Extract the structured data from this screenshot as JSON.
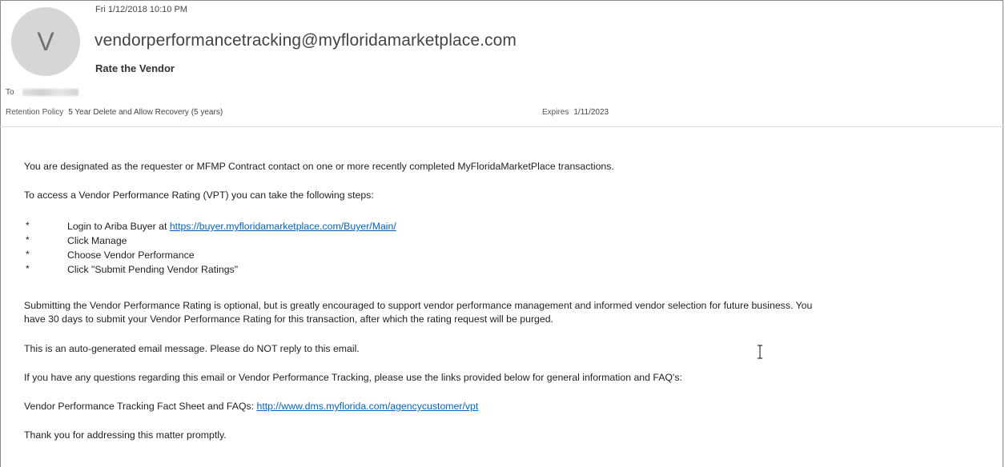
{
  "header": {
    "avatar_letter": "V",
    "date": "Fri 1/12/2018 10:10 PM",
    "sender": "vendorperformancetracking@myfloridamarketplace.com",
    "subject": "Rate the Vendor",
    "to_label": "To",
    "retention_label": "Retention Policy",
    "retention_value": "5 Year Delete and Allow Recovery (5 years)",
    "expires_label": "Expires",
    "expires_value": "1/11/2023"
  },
  "body": {
    "intro": "You are designated as the requester or MFMP Contract contact on one or more recently completed MyFloridaMarketPlace transactions.",
    "steps_intro": "To access a Vendor Performance Rating (VPT) you can take the following steps:",
    "bullet_char": "*",
    "step1_text": "Login to Ariba Buyer at ",
    "step1_link": "https://buyer.myfloridamarketplace.com/Buyer/Main/",
    "step2": "Click Manage",
    "step3": "Choose Vendor Performance",
    "step4": "Click \"Submit Pending Vendor Ratings\"",
    "optional_line1": "Submitting the Vendor Performance Rating is optional, but is greatly encouraged to support vendor performance management and informed vendor selection for future business.  You",
    "optional_line2": "have 30 days to submit your Vendor Performance Rating for this transaction, after which the rating request will be purged.",
    "auto_generated": "This is an auto-generated email message.  Please do NOT reply to this email.",
    "questions": "If you have any questions regarding this email or Vendor Performance Tracking, please use the links provided below for general information and FAQ's:",
    "factsheet_text": "Vendor Performance Tracking Fact Sheet and FAQs: ",
    "factsheet_link": "http://www.dms.myflorida.com/agencycustomer/vpt",
    "thanks": "Thank you for addressing this matter promptly."
  },
  "icons": {
    "cursor": "text-cursor-icon"
  }
}
